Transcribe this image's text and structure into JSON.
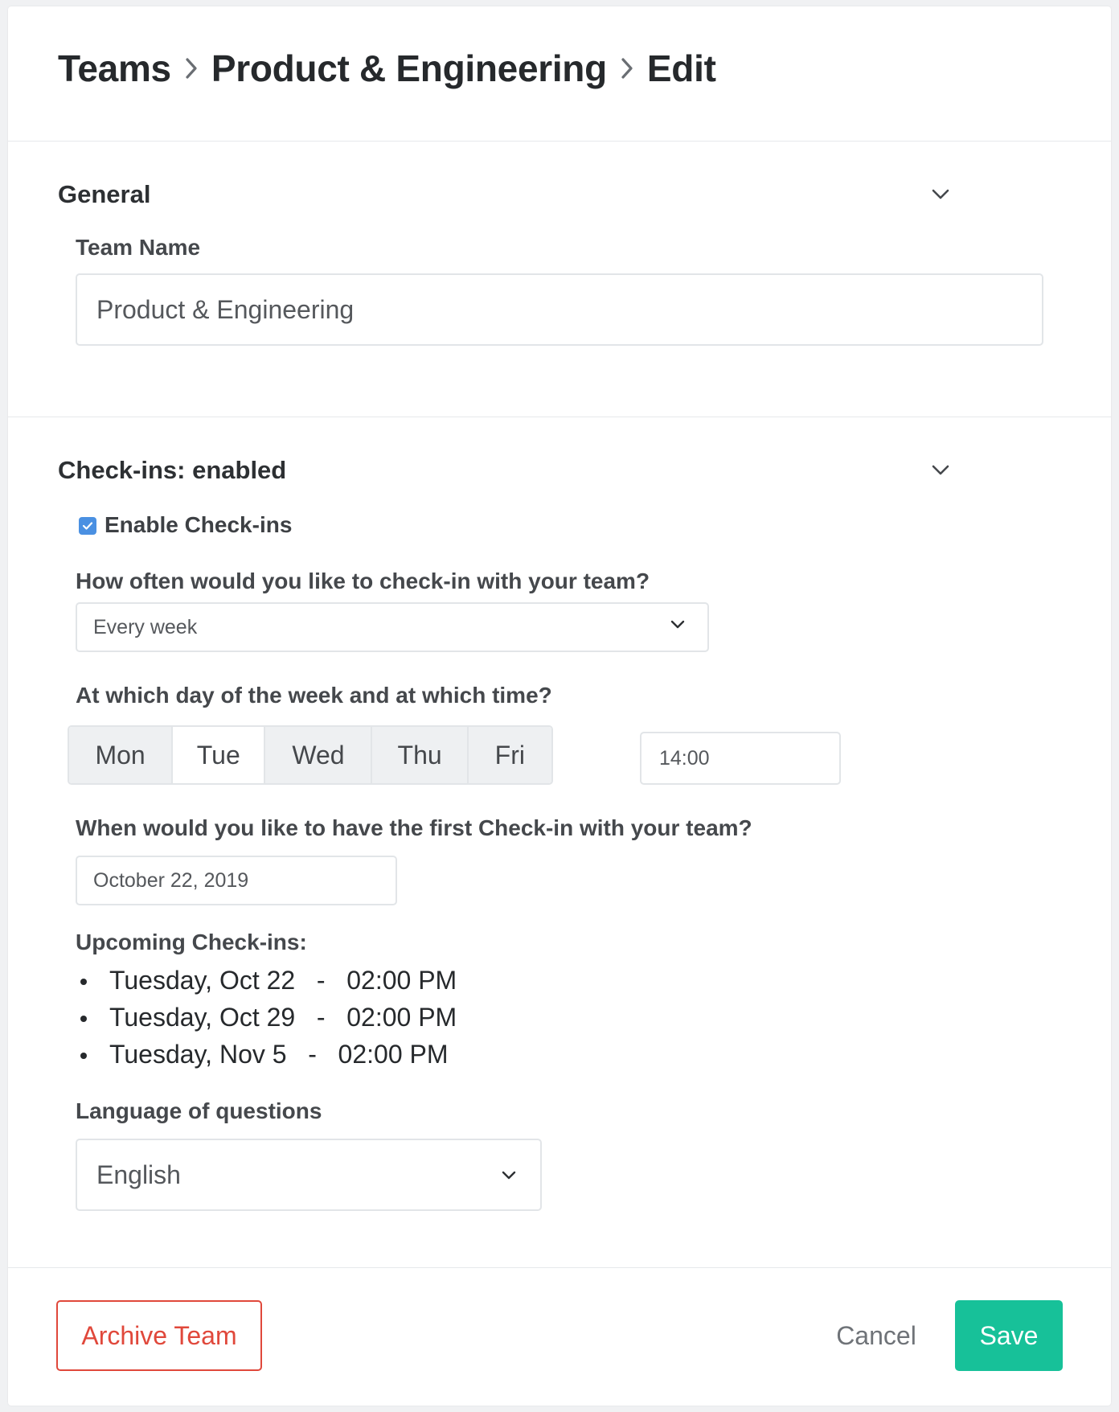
{
  "breadcrumb": {
    "items": [
      "Teams",
      "Product & Engineering",
      "Edit"
    ]
  },
  "general": {
    "title": "General",
    "team_name_label": "Team Name",
    "team_name_value": "Product & Engineering"
  },
  "checkins": {
    "title": "Check-ins: enabled",
    "enable_label": "Enable Check-ins",
    "enabled": true,
    "frequency_label": "How often would you like to check-in with your team?",
    "frequency_value": "Every week",
    "day_time_label": "At which day of the week and at which time?",
    "days": [
      "Mon",
      "Tue",
      "Wed",
      "Thu",
      "Fri"
    ],
    "selected_day": "Tue",
    "time_value": "14:00",
    "first_checkin_label": "When would you like to have the first Check-in with your team?",
    "first_checkin_value": "October 22, 2019",
    "upcoming_label": "Upcoming Check-ins:",
    "upcoming": [
      "Tuesday, Oct 22   -   02:00 PM",
      "Tuesday, Oct 29   -   02:00 PM",
      "Tuesday, Nov 5   -   02:00 PM"
    ],
    "language_label": "Language of questions",
    "language_value": "English"
  },
  "footer": {
    "archive_label": "Archive Team",
    "cancel_label": "Cancel",
    "save_label": "Save"
  },
  "colors": {
    "accent_save": "#17c199",
    "danger": "#e0483b",
    "checkbox": "#4a90e2"
  },
  "icons": {
    "breadcrumb_separator": "chevron-right-icon",
    "section_toggle": "chevron-down-icon",
    "select_arrow": "chevron-down-icon",
    "checkbox_mark": "check-icon"
  }
}
